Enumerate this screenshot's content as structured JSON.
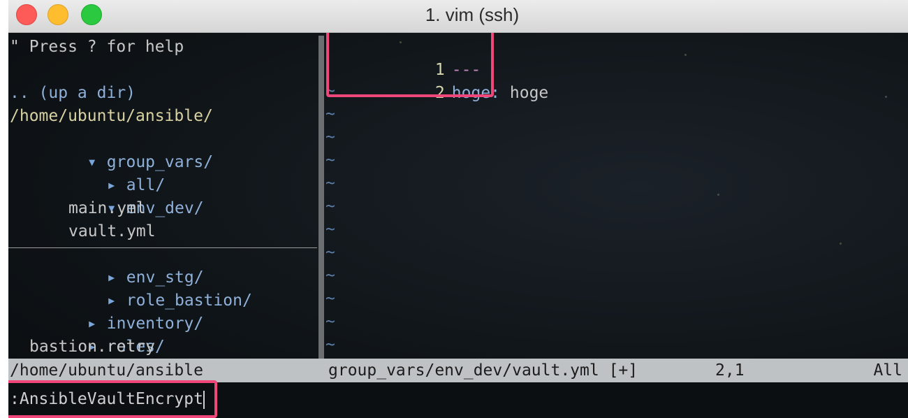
{
  "window": {
    "title": "1. vim (ssh)"
  },
  "nerdtree": {
    "help": "\" Press ? for help",
    "up_dir": ".. (up a dir)",
    "root": "/home/ubuntu/ansible/",
    "items": [
      {
        "label": "group_vars/",
        "type": "dir",
        "open": true,
        "depth": 0
      },
      {
        "label": "all/",
        "type": "dir",
        "open": false,
        "depth": 1
      },
      {
        "label": "env_dev/",
        "type": "dir",
        "open": true,
        "depth": 1
      },
      {
        "label": "main.yml",
        "type": "file",
        "depth": 2
      },
      {
        "label": "vault.yml",
        "type": "file",
        "depth": 2
      },
      {
        "label": "env_stg/",
        "type": "dir",
        "open": false,
        "depth": 1
      },
      {
        "label": "role_bastion/",
        "type": "dir",
        "open": false,
        "depth": 1
      },
      {
        "label": "inventory/",
        "type": "dir",
        "open": false,
        "depth": 0
      },
      {
        "label": "roles/",
        "type": "dir",
        "open": false,
        "depth": 0
      },
      {
        "label": "bastion.retry",
        "type": "file",
        "depth": 0
      }
    ],
    "status": "/home/ubuntu/ansible"
  },
  "buffer": {
    "lines": [
      {
        "num": "1",
        "content": "---"
      },
      {
        "num": "2",
        "key": "hoge:",
        "value": " hoge"
      }
    ],
    "filler": "~",
    "status_file": "group_vars/env_dev/vault.yml [+]",
    "status_pos": "2,1",
    "status_scroll": "All"
  },
  "cmdline": {
    "text": ":AnsibleVaultEncrypt"
  },
  "colors": {
    "highlight": "#f0477a",
    "dir": "#8fb0d8",
    "path": "#d8d1a2",
    "tilde": "#5d7fa8"
  }
}
